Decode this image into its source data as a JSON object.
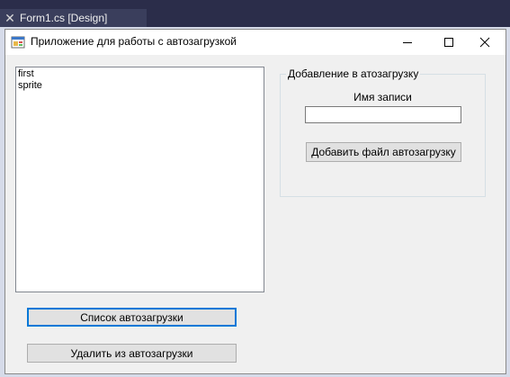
{
  "ide": {
    "tab_label": "Form1.cs [Design]",
    "tab_close_glyph": "✕"
  },
  "window": {
    "title": "Приложение для работы с автозагрузкой",
    "icon": "windows-form-icon"
  },
  "startup_list": {
    "items": [
      "first",
      "sprite"
    ]
  },
  "add_group": {
    "legend": "Добавление в атозагрузку",
    "name_label": "Имя записи",
    "name_value": "",
    "add_button_label": "Добавить файл автозагрузку"
  },
  "actions": {
    "list_button_label": "Список автозагрузки",
    "remove_button_label": "Удалить из автозагрузки"
  },
  "colors": {
    "ide_background": "#2b2d4a",
    "form_background": "#f0f0f0",
    "focus_accent": "#0078d7"
  }
}
